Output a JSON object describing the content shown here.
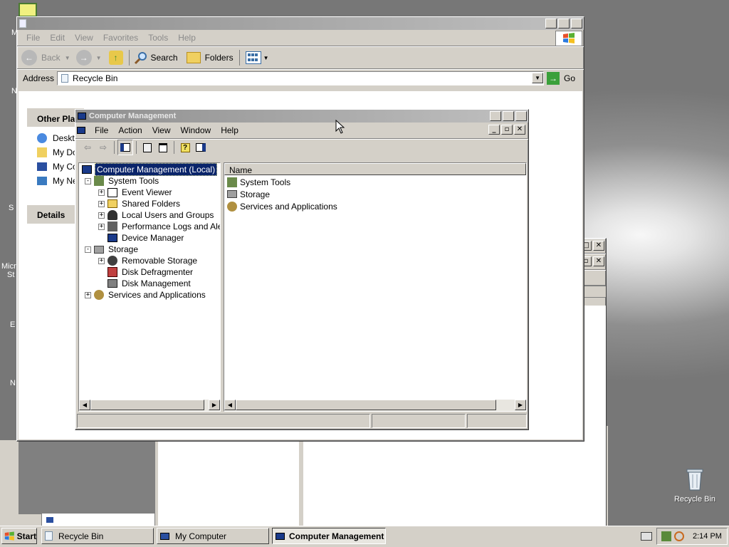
{
  "desktop": {
    "recycle_bin_label": "Recycle Bin",
    "left_fragments": [
      "M",
      "N",
      "S",
      "Micr",
      "St",
      "E",
      "N"
    ]
  },
  "explorer": {
    "menu": [
      "File",
      "Edit",
      "View",
      "Favorites",
      "Tools",
      "Help"
    ],
    "toolbar": {
      "back": "Back",
      "search": "Search",
      "folders": "Folders"
    },
    "address_label": "Address",
    "address_value": "Recycle Bin",
    "go_label": "Go",
    "other_places_title": "Other Pla",
    "other_places": [
      "Deskto",
      "My Do",
      "My Co",
      "My Ne"
    ],
    "details_title": "Details"
  },
  "mmc": {
    "title": "Computer Management",
    "menu": [
      "File",
      "Action",
      "View",
      "Window",
      "Help"
    ],
    "tree": [
      {
        "label": "Computer Management (Local)",
        "level": 0,
        "expander": "",
        "selected": true
      },
      {
        "label": "System Tools",
        "level": 1,
        "expander": "-"
      },
      {
        "label": "Event Viewer",
        "level": 2,
        "expander": "+"
      },
      {
        "label": "Shared Folders",
        "level": 2,
        "expander": "+"
      },
      {
        "label": "Local Users and Groups",
        "level": 2,
        "expander": "+"
      },
      {
        "label": "Performance Logs and Alerts",
        "level": 2,
        "expander": "+"
      },
      {
        "label": "Device Manager",
        "level": 2,
        "expander": ""
      },
      {
        "label": "Storage",
        "level": 1,
        "expander": "-"
      },
      {
        "label": "Removable Storage",
        "level": 2,
        "expander": "+"
      },
      {
        "label": "Disk Defragmenter",
        "level": 2,
        "expander": ""
      },
      {
        "label": "Disk Management",
        "level": 2,
        "expander": ""
      },
      {
        "label": "Services and Applications",
        "level": 1,
        "expander": "+"
      }
    ],
    "list_header": "Name",
    "list_items": [
      "System Tools",
      "Storage",
      "Services and Applications"
    ]
  },
  "taskbar": {
    "start": "Start",
    "buttons": [
      "Recycle Bin",
      "My Computer",
      "Computer Management"
    ],
    "clock": "2:14 PM"
  }
}
